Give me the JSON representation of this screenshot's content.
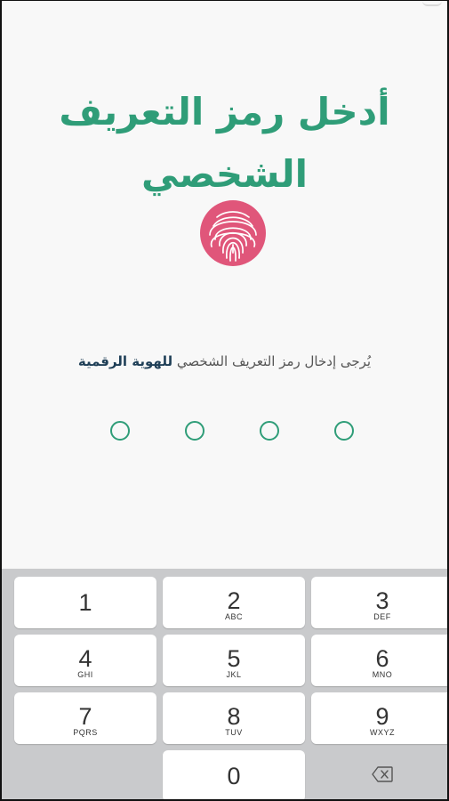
{
  "header": {
    "title": "أدخل رمز التعريف الشخصي"
  },
  "instruction": {
    "text": "يُرجى إدخال رمز التعريف الشخصي",
    "bold_text": "للهوية الرقمية"
  },
  "pin": {
    "digits_total": 4,
    "digits_entered": 0
  },
  "keypad": {
    "keys": [
      {
        "digit": "1",
        "letters": ""
      },
      {
        "digit": "2",
        "letters": "ABC"
      },
      {
        "digit": "3",
        "letters": "DEF"
      },
      {
        "digit": "4",
        "letters": "GHI"
      },
      {
        "digit": "5",
        "letters": "JKL"
      },
      {
        "digit": "6",
        "letters": "MNO"
      },
      {
        "digit": "7",
        "letters": "PQRS"
      },
      {
        "digit": "8",
        "letters": "TUV"
      },
      {
        "digit": "9",
        "letters": "WXYZ"
      },
      {
        "digit": "0",
        "letters": ""
      }
    ],
    "backspace_icon": "backspace-icon"
  },
  "colors": {
    "accent": "#2f9d78",
    "fingerprint": "#e0567a",
    "instruction_bold": "#1f3f57",
    "keypad_bg": "#c9cacc"
  }
}
